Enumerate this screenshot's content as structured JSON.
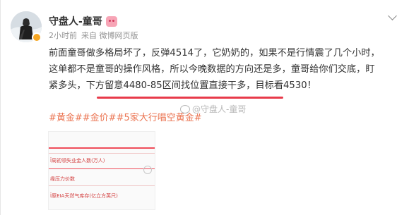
{
  "post": {
    "author": "守盘人-童哥",
    "time": "2小时前",
    "source": "来自 微博网页版",
    "body_part1": "前面童哥做多格局坏了，反弹4514了，它奶奶的，如果不是行情震了几个小时，这单都不是童哥的操作风格，所以今晚数据的方向还是多，童哥给你们交底，盯紧多头，",
    "body_part2": "下方留意4480-85区间找位置直接干多，目标看4530！",
    "tags": "#黄金##金价##5家大行唱空黄金#",
    "watermark": "@守盘人-童哥"
  },
  "thumbnail": {
    "rows": [
      "Ï周初领失业金人数(万人)",
      "缘压力价数",
      "Ï原EIA天然气库存(亿立方英尺)"
    ]
  },
  "colors": {
    "accent": "#e83a4a",
    "tag": "#eb7350",
    "meta": "#939393"
  }
}
